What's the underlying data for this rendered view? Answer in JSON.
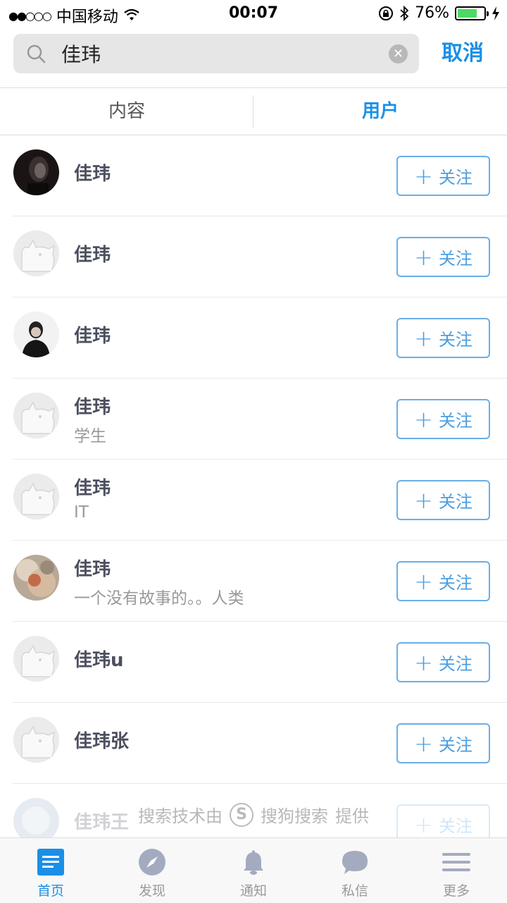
{
  "status": {
    "signal": "●●○○○",
    "carrier": "中国移动",
    "time": "00:07",
    "battery": "76%"
  },
  "search": {
    "query": "佳玮",
    "cancel": "取消"
  },
  "tabs": [
    "内容",
    "用户"
  ],
  "follow_label": "关注",
  "users": [
    {
      "name": "佳玮",
      "sub": ""
    },
    {
      "name": "佳玮",
      "sub": ""
    },
    {
      "name": "佳玮",
      "sub": ""
    },
    {
      "name": "佳玮",
      "sub": "学生"
    },
    {
      "name": "佳玮",
      "sub": "IT"
    },
    {
      "name": "佳玮",
      "sub": "一个没有故事的。。人类"
    },
    {
      "name": "佳玮u",
      "sub": ""
    },
    {
      "name": "佳玮张",
      "sub": ""
    },
    {
      "name": "佳玮王",
      "sub": ""
    }
  ],
  "credit": {
    "prefix": "搜索技术由",
    "brand": "搜狗搜索",
    "suffix": "提供"
  },
  "tabbar": [
    "首页",
    "发现",
    "通知",
    "私信",
    "更多"
  ],
  "colors": {
    "accent": "#1a8fe8",
    "battery": "#4cd964"
  }
}
